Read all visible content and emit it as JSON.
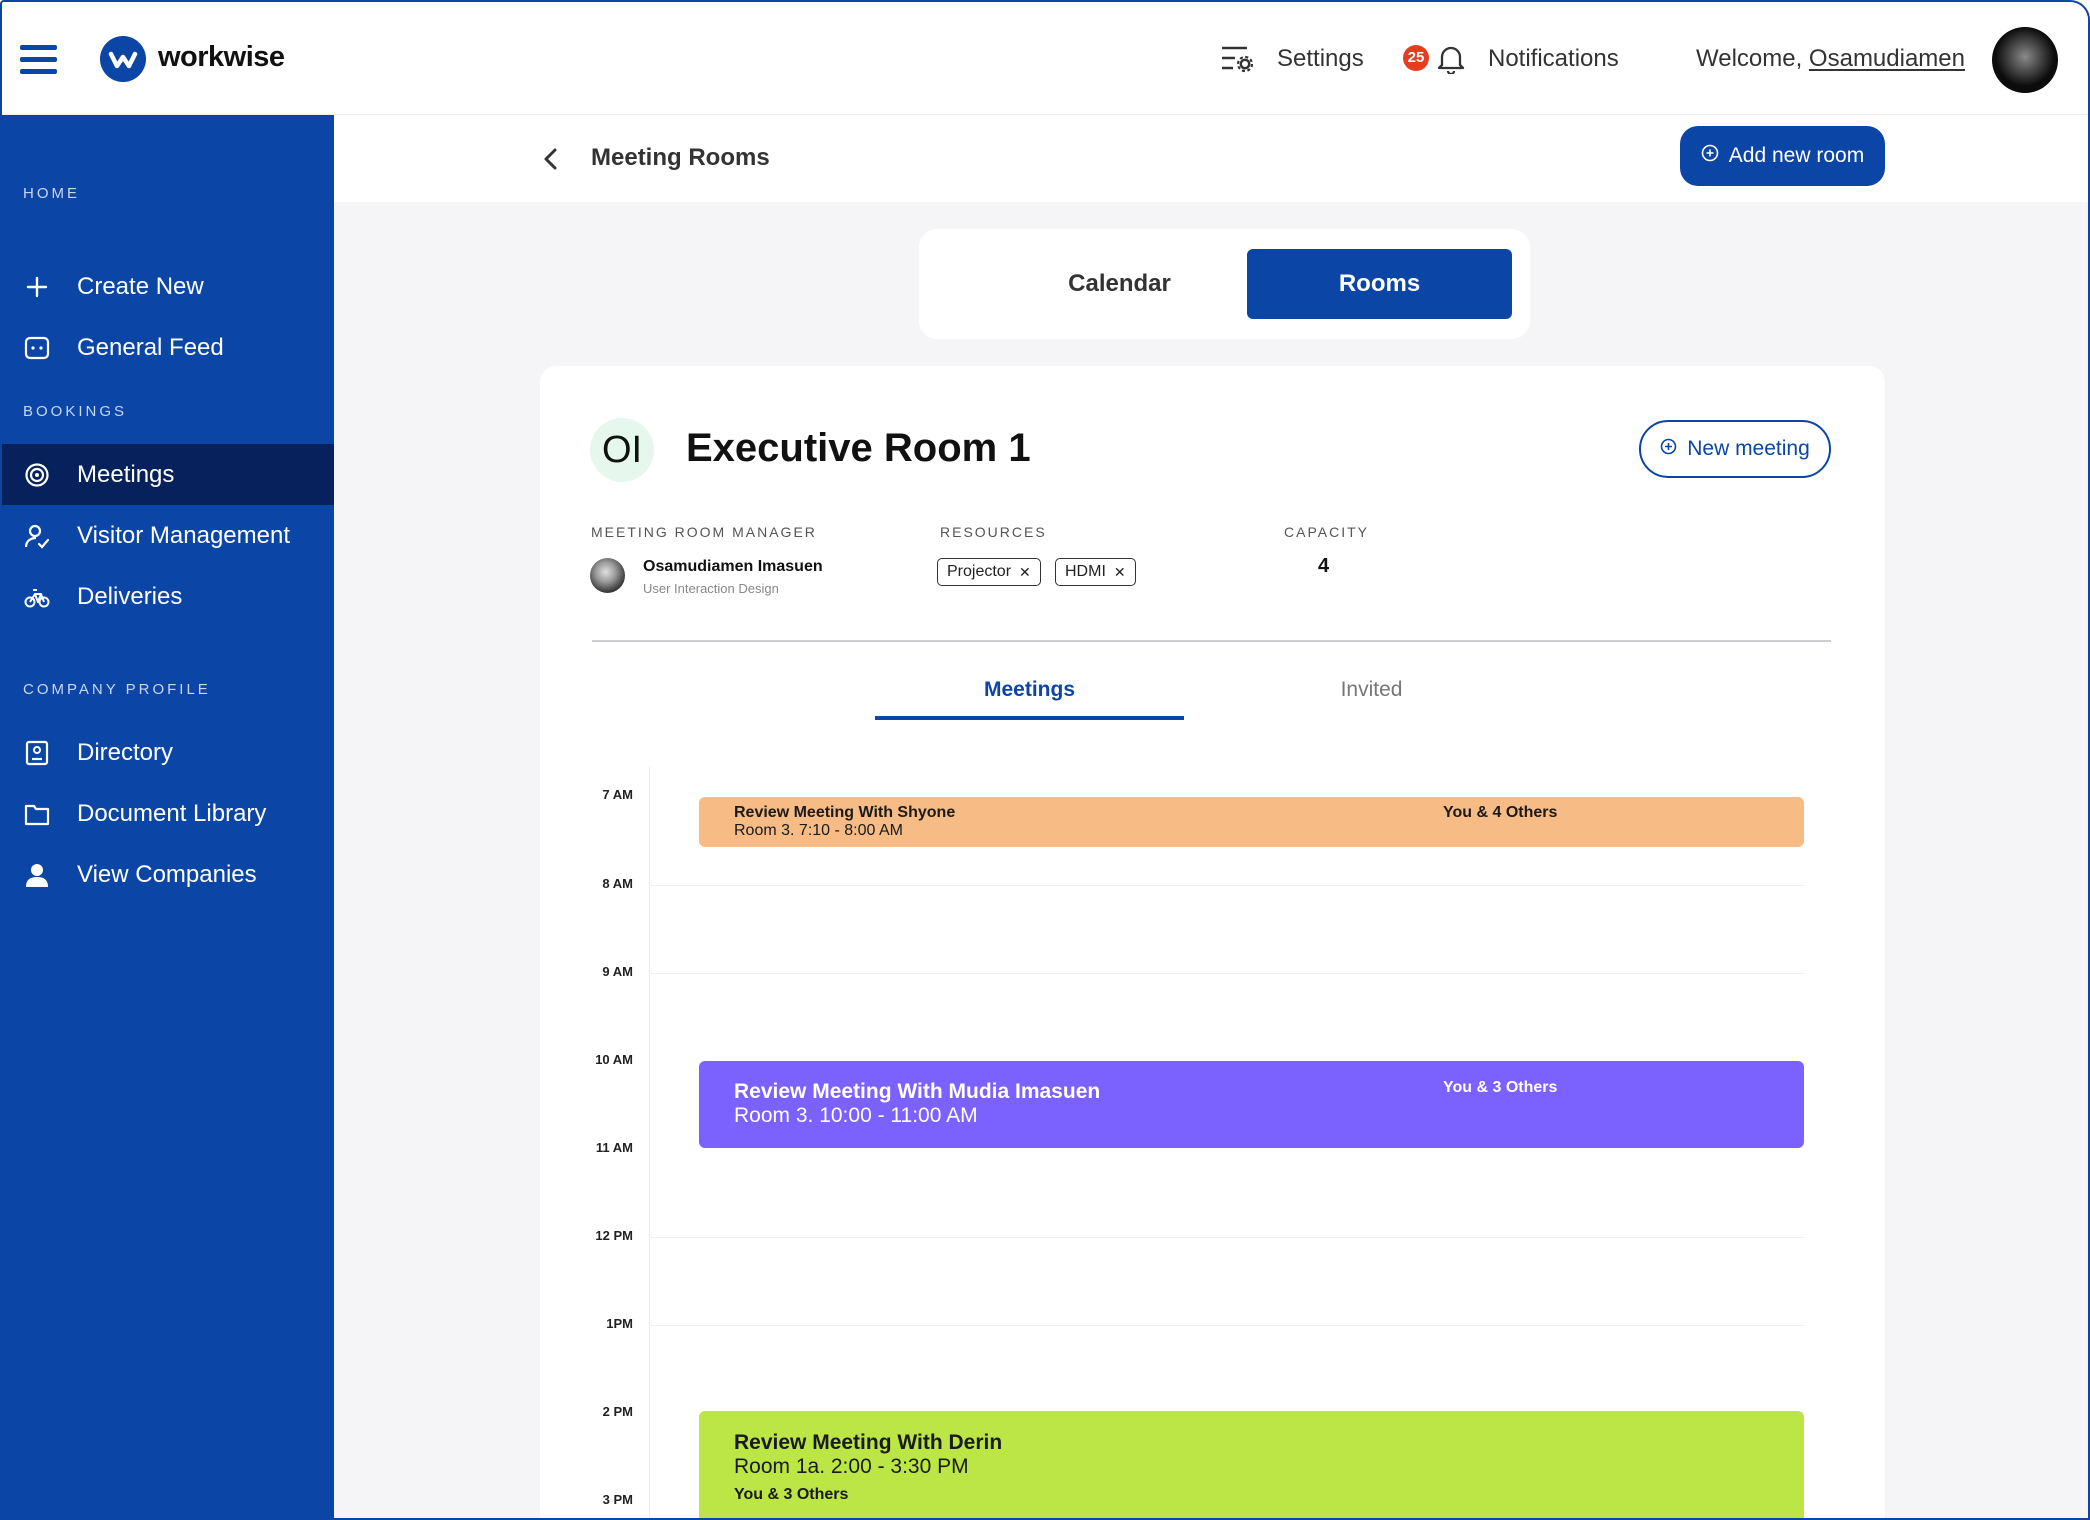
{
  "header": {
    "brand": "workwise",
    "settings_label": "Settings",
    "notification_count": "25",
    "notifications_label": "Notifications",
    "welcome_prefix": "Welcome, ",
    "user_name": "Osamudiamen"
  },
  "sidebar": {
    "sections": [
      {
        "heading": "HOME",
        "items": [
          {
            "label": "Create New",
            "icon": "plus-icon"
          },
          {
            "label": "General Feed",
            "icon": "feed-icon"
          }
        ]
      },
      {
        "heading": "BOOKINGS",
        "items": [
          {
            "label": "Meetings",
            "icon": "target-icon",
            "active": true
          },
          {
            "label": "Visitor Management",
            "icon": "visitor-icon"
          },
          {
            "label": "Deliveries",
            "icon": "bicycle-icon"
          }
        ]
      },
      {
        "heading": "COMPANY PROFILE",
        "items": [
          {
            "label": "Directory",
            "icon": "directory-icon"
          },
          {
            "label": "Document Library",
            "icon": "folder-icon"
          },
          {
            "label": "View Companies",
            "icon": "person-icon"
          }
        ]
      }
    ]
  },
  "page": {
    "title": "Meeting Rooms",
    "add_room_label": "Add new room",
    "toggle": {
      "calendar_label": "Calendar",
      "rooms_label": "Rooms",
      "active": "Rooms"
    }
  },
  "room": {
    "initials": "OI",
    "name": "Executive Room 1",
    "new_meeting_label": "New meeting",
    "manager_label": "MEETING ROOM MANAGER",
    "manager_name": "Osamudiamen Imasuen",
    "manager_role": "User Interaction Design",
    "resources_label": "RESOURCES",
    "resources": [
      "Projector",
      "HDMI"
    ],
    "capacity_label": "CAPACITY",
    "capacity": "4"
  },
  "tabs": {
    "meetings_label": "Meetings",
    "invited_label": "Invited",
    "active": "Meetings"
  },
  "schedule": {
    "hours": [
      "7 AM",
      "8 AM",
      "9 AM",
      "10 AM",
      "11 AM",
      "12 PM",
      "1PM",
      "2 PM",
      "3 PM"
    ],
    "events": [
      {
        "title": "Review Meeting With Shyone",
        "details": "Room 3. 7:10 - 8:00 AM",
        "attendees": "You & 4 Others",
        "color": "#f7bb86"
      },
      {
        "title": "Review Meeting With Mudia Imasuen",
        "details": "Room 3. 10:00 - 11:00 AM",
        "attendees": "You & 3 Others",
        "color": "#7b61fe"
      },
      {
        "title": "Review Meeting With Derin",
        "details": "Room 1a. 2:00 - 3:30 PM",
        "attendees": "You & 3 Others",
        "color": "#bbe645"
      }
    ]
  },
  "colors": {
    "brand": "#0b45a6",
    "sidebar_active": "#07215c",
    "badge": "#e53d1f"
  }
}
